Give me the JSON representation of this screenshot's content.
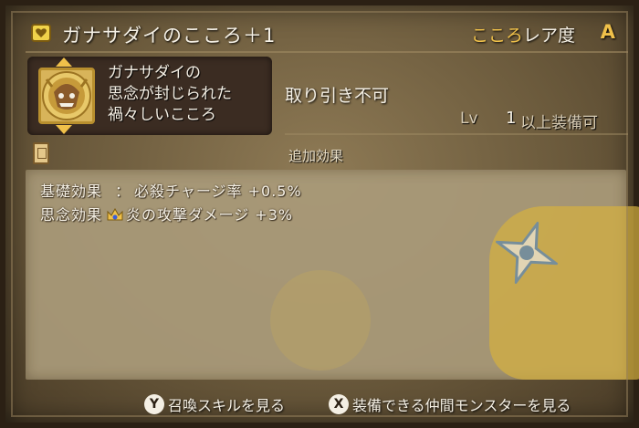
{
  "header": {
    "title": "ガナサダイのこころ＋1",
    "rarity_prefix": "こころ",
    "rarity_label": "レア度",
    "rarity_value": "A"
  },
  "item": {
    "description_lines": [
      "ガナサダイの",
      "思念が封じられた",
      "禍々しいこころ"
    ],
    "trade_status": "取り引き不可",
    "lv_label": "Lv",
    "lv_value": "1",
    "lv_suffix": "以上装備可"
  },
  "effects": {
    "header": "追加効果",
    "rows": [
      {
        "label": "基礎効果",
        "separator": "：",
        "text": "必殺チャージ率 +0.5%"
      },
      {
        "label": "思念効果",
        "separator": "",
        "text": "炎の攻撃ダメージ +3%"
      }
    ]
  },
  "footer": {
    "y_button": {
      "key": "Y",
      "label": "召喚スキルを見る"
    },
    "x_button": {
      "key": "X",
      "label": "装備できる仲間モンスターを見る"
    }
  },
  "colors": {
    "accent_gold": "#f0c14a",
    "text_light": "#f4efe4",
    "panel_dark": "#3b2c22"
  }
}
